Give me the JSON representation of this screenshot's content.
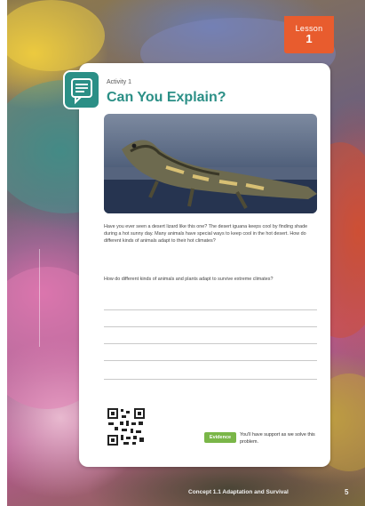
{
  "lesson_badge": {
    "label": "Lesson",
    "number": "1"
  },
  "activity": {
    "kicker": "Activity 1",
    "title": "Can You Explain?",
    "icon": "speech-bubble-lines-icon"
  },
  "body": {
    "paragraph1": "Have you ever seen a desert lizard like this one? The desert iguana keeps cool by finding shade during a hot sunny day. Many animals have special ways to keep cool in the hot desert. How do different kinds of animals adapt to their hot climates?",
    "paragraph2": "How do different kinds of animals and plants adapt to survive extreme climates?"
  },
  "footer": {
    "answer_button": "Evidence",
    "answer_text": "You'll have support as we solve this problem.",
    "unit": "Concept 1.1 Adaptation and Survival",
    "page_number": "5"
  },
  "colors": {
    "accent": "#2b8f86",
    "badge": "#e85c2e",
    "answer": "#7ab648"
  }
}
